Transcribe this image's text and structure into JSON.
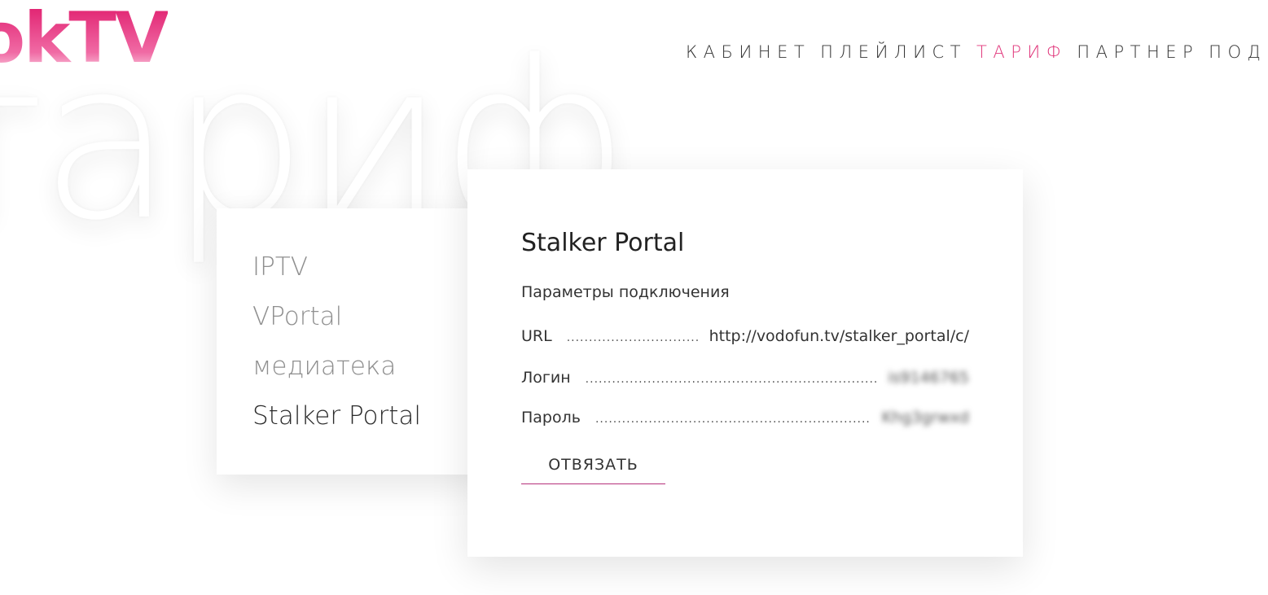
{
  "logo": {
    "text": "okTV"
  },
  "nav": {
    "items": [
      {
        "label": "КАБИНЕТ"
      },
      {
        "label": "ПЛЕЙЛИСТ"
      },
      {
        "label": "ТАРИФ"
      },
      {
        "label": "ПАРТНЕР"
      },
      {
        "label": "ПОД"
      }
    ],
    "active_index": 2,
    "active_color": "#e0357a"
  },
  "watermark": {
    "text": "тариф"
  },
  "side_menu": {
    "items": [
      {
        "label": "IPTV"
      },
      {
        "label": "VPortal"
      },
      {
        "label": "медиатека"
      },
      {
        "label": "Stalker Portal"
      }
    ],
    "active_index": 3
  },
  "card": {
    "title": "Stalker Portal",
    "subtitle": "Параметры подключения",
    "url": {
      "label": "URL",
      "value": "http://vodofun.tv/stalker_portal/c/"
    },
    "login": {
      "label": "Логин",
      "value": "is9146765"
    },
    "password": {
      "label": "Пароль",
      "value": "Khg3grwxd"
    },
    "unbind_button": "ОТВЯЗАТЬ"
  },
  "colors": {
    "brand": "#e01e6e",
    "accent_underline": "#b5307a"
  }
}
